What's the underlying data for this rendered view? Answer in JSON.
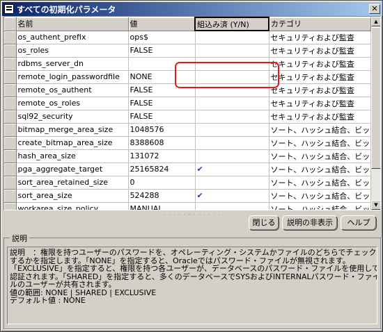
{
  "window": {
    "title": "すべての初期化パラメータ",
    "close_glyph": "✕"
  },
  "grid": {
    "columns": [
      "名前",
      "値",
      "組込み済 (Y/N)",
      "カテゴリ"
    ],
    "rows": [
      {
        "name": "os_authent_prefix",
        "value": "ops$",
        "builtin": "",
        "category": "セキュリティおよび監査"
      },
      {
        "name": "os_roles",
        "value": "FALSE",
        "builtin": "",
        "category": "セキュリティおよび監査"
      },
      {
        "name": "rdbms_server_dn",
        "value": "",
        "builtin": "",
        "category": "セキュリティおよび監査"
      },
      {
        "name": "remote_login_passwordfile",
        "value": "NONE",
        "builtin": "",
        "category": "セキュリティおよび監査"
      },
      {
        "name": "remote_os_authent",
        "value": "FALSE",
        "builtin": "",
        "category": "セキュリティおよび監査"
      },
      {
        "name": "remote_os_roles",
        "value": "FALSE",
        "builtin": "",
        "category": "セキュリティおよび監査"
      },
      {
        "name": "sql92_security",
        "value": "FALSE",
        "builtin": "",
        "category": "セキュリティおよび監査"
      },
      {
        "name": "bitmap_merge_area_size",
        "value": "1048576",
        "builtin": "",
        "category": "ソート、ハッシュ結合、ビット..."
      },
      {
        "name": "create_bitmap_area_size",
        "value": "8388608",
        "builtin": "",
        "category": "ソート、ハッシュ結合、ビット..."
      },
      {
        "name": "hash_area_size",
        "value": "131072",
        "builtin": "",
        "category": "ソート、ハッシュ結合、ビット..."
      },
      {
        "name": "pga_aggregate_target",
        "value": "25165824",
        "builtin": "✔",
        "category": "ソート、ハッシュ結合、ビット..."
      },
      {
        "name": "sort_area_retained_size",
        "value": "0",
        "builtin": "",
        "category": "ソート、ハッシュ結合、ビット..."
      },
      {
        "name": "sort_area_size",
        "value": "524288",
        "builtin": "✔",
        "category": "ソート、ハッシュ結合、ビット..."
      },
      {
        "name": "workarea_size_policy",
        "value": "MANUAL",
        "builtin": "",
        "category": "ソート、ハッシュ結合、ビット..."
      }
    ]
  },
  "scrollbar": {
    "up_glyph": "▲",
    "down_glyph": "▼"
  },
  "splitter": "· · · · · · · · · · · ·",
  "buttons": {
    "close": "閉じる",
    "hide_description": "説明の非表示",
    "help": "ヘルプ"
  },
  "description": {
    "group_label": "説明",
    "lines": [
      "説明　：権限を持つユーザーのパスワードを、オペレーティング・システムかファイルのどちらでチェック",
      "するかを指定します。「NONE」を指定すると、Oracleではパスワード・ファイルが無視されます。",
      "「EXCLUSIVE」を指定すると、権限を持つ各ユーザーが、データベースのパスワード・ファイルを使用して",
      "認証されます。「SHARED」を指定すると、多くのデータベースでSYSおよびINTERNALパスワード・ファイ",
      "ルのユーザーが共有されます。",
      "値の範囲: NONE | SHARED | EXCLUSIVE",
      "デフォルト値 : NONE"
    ]
  },
  "colors": {
    "title_gradient_start": "#0a246a",
    "annotation_red": "#e31b1b",
    "check_blue": "#1a3fa8"
  }
}
